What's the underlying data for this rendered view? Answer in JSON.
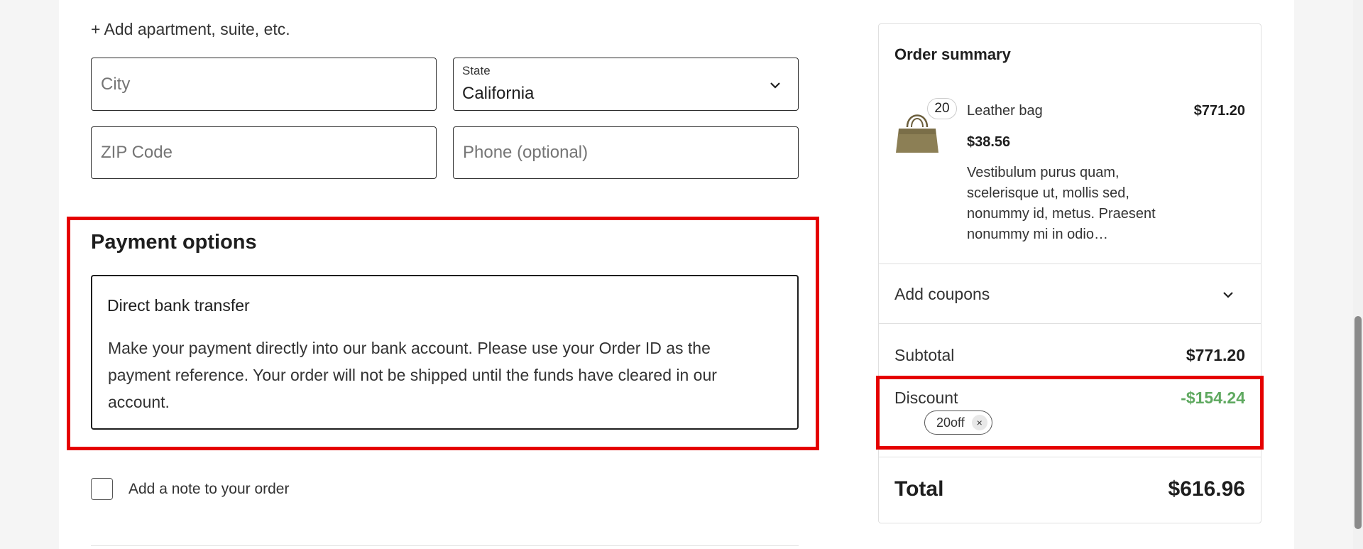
{
  "address": {
    "add_apartment_label": "+ Add apartment, suite, etc.",
    "city_placeholder": "City",
    "state_label": "State",
    "state_value": "California",
    "zip_placeholder": "ZIP Code",
    "phone_placeholder": "Phone (optional)"
  },
  "payment": {
    "title": "Payment options",
    "method_label": "Direct bank transfer",
    "description": "Make your payment directly into our bank account. Please use your Order ID as the payment reference. Your order will not be shipped until the funds have cleared in our account."
  },
  "note": {
    "label": "Add a note to your order"
  },
  "summary": {
    "title": "Order summary",
    "item": {
      "quantity": "20",
      "name": "Leather bag",
      "line_total": "$771.20",
      "unit_price": "$38.56",
      "description": "Vestibulum purus quam, scelerisque ut, mollis sed, nonummy id, metus. Praesent nonummy mi in odio…"
    },
    "coupons_label": "Add coupons",
    "subtotal_label": "Subtotal",
    "subtotal_value": "$771.20",
    "discount_label": "Discount",
    "discount_value": "-$154.24",
    "coupon_code": "20off",
    "coupon_remove_symbol": "×",
    "total_label": "Total",
    "total_value": "$616.96"
  },
  "colors": {
    "highlight": "#e50000",
    "discount": "#5fa960"
  },
  "icons": {
    "state_dropdown": "chevron-down-icon",
    "coupons_toggle": "chevron-down-icon",
    "coupon_remove": "close-icon",
    "product_image": "leather-bag-icon"
  }
}
